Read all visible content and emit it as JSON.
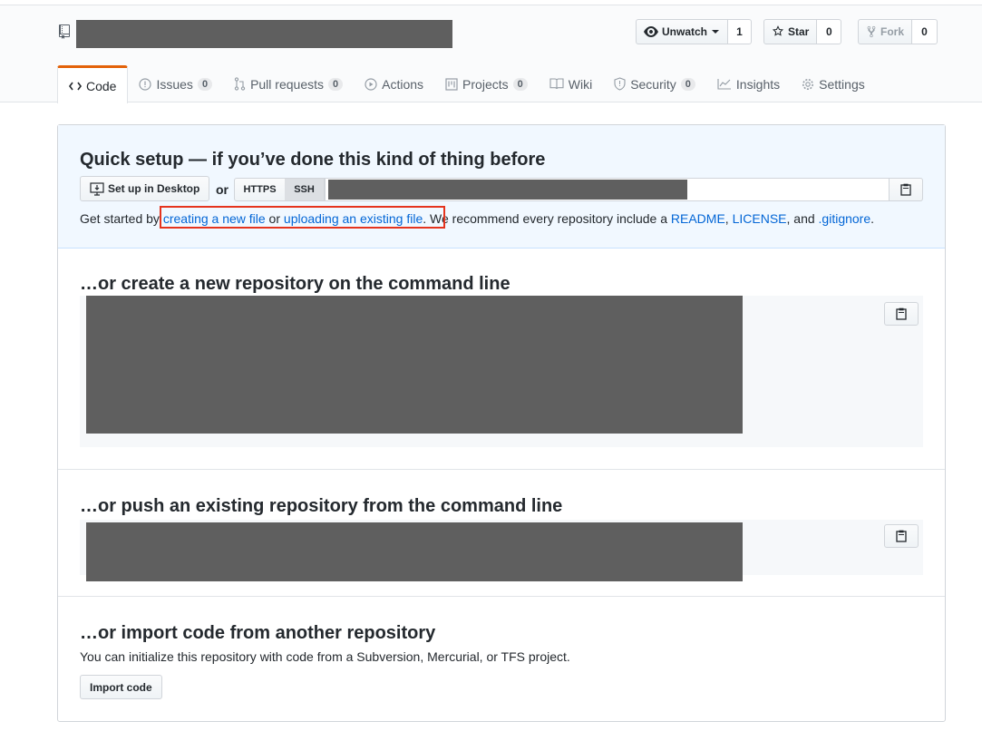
{
  "header": {
    "watch": {
      "label": "Unwatch",
      "count": "1"
    },
    "star": {
      "label": "Star",
      "count": "0"
    },
    "fork": {
      "label": "Fork",
      "count": "0"
    }
  },
  "tabs": [
    {
      "label": "Code",
      "icon": "code-icon"
    },
    {
      "label": "Issues",
      "count": "0",
      "icon": "issue-icon"
    },
    {
      "label": "Pull requests",
      "count": "0",
      "icon": "pull-request-icon"
    },
    {
      "label": "Actions",
      "icon": "play-icon"
    },
    {
      "label": "Projects",
      "count": "0",
      "icon": "project-icon"
    },
    {
      "label": "Wiki",
      "icon": "book-icon"
    },
    {
      "label": "Security",
      "count": "0",
      "icon": "shield-icon"
    },
    {
      "label": "Insights",
      "icon": "graph-icon"
    },
    {
      "label": "Settings",
      "icon": "gear-icon"
    }
  ],
  "quick_setup": {
    "title": "Quick setup — if you’ve done this kind of thing before",
    "desktop_button": "Set up in Desktop",
    "or": "or",
    "https": "HTTPS",
    "ssh": "SSH",
    "started_prefix": "Get started by ",
    "link_new_file": "creating a new file",
    "or_word": " or ",
    "link_upload": "uploading an existing file",
    "mid_text": ". We recommend every repository include a ",
    "link_readme": "README",
    "comma": ", ",
    "link_license": "LICENSE",
    "and_word": ", and ",
    "link_gitignore": ".gitignore",
    "period": "."
  },
  "sections": {
    "create_title": "…or create a new repository on the command line",
    "push_title": "…or push an existing repository from the command line",
    "import_title": "…or import code from another repository",
    "import_text": "You can initialize this repository with code from a Subversion, Mercurial, or TFS project.",
    "import_button": "Import code"
  },
  "colors": {
    "accent_tab": "#e36209",
    "link": "#0366d6",
    "highlight": "#e5341e"
  }
}
